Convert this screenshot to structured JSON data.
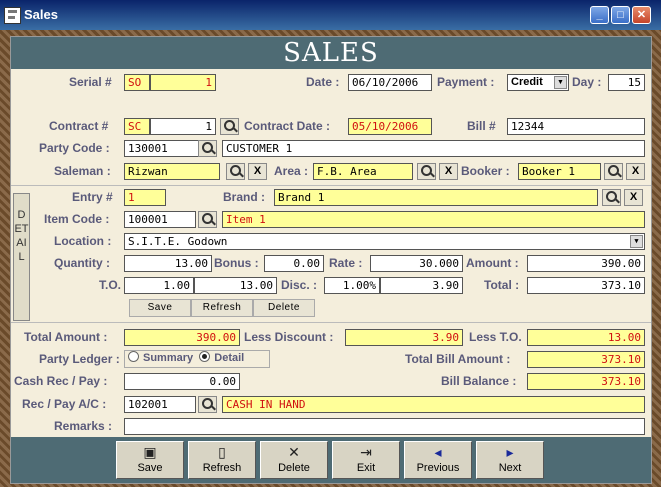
{
  "window": {
    "title": "Sales"
  },
  "banner": "SALES",
  "header": {
    "serial_label": "Serial #",
    "serial_prefix": "SO",
    "serial_no": "1",
    "date_label": "Date :",
    "date": "06/10/2006",
    "payment_label": "Payment :",
    "payment": "Credit",
    "day_label": "Day :",
    "day": "15"
  },
  "contract": {
    "label": "Contract #",
    "prefix": "SC",
    "no": "1",
    "date_label": "Contract Date :",
    "date": "05/10/2006",
    "bill_label": "Bill #",
    "bill": "12344"
  },
  "party": {
    "label": "Party Code :",
    "code": "130001",
    "name": "CUSTOMER 1"
  },
  "people": {
    "saleman_label": "Saleman :",
    "saleman": "Rizwan",
    "area_label": "Area :",
    "area": "F.B. Area",
    "booker_label": "Booker :",
    "booker": "Booker 1"
  },
  "detail": {
    "tab_label": "DETAIL",
    "entry_label": "Entry #",
    "entry": "1",
    "brand_label": "Brand :",
    "brand": "Brand 1",
    "item_code_label": "Item Code :",
    "item_code": "100001",
    "item_name": "Item 1",
    "location_label": "Location :",
    "location": "S.I.T.E. Godown",
    "quantity_label": "Quantity :",
    "quantity": "13.00",
    "bonus_label": "Bonus :",
    "bonus": "0.00",
    "rate_label": "Rate :",
    "rate": "30.000",
    "amount_label": "Amount :",
    "amount": "390.00",
    "to_label": "T.O.",
    "to_a": "1.00",
    "to_b": "13.00",
    "disc_label": "Disc. :",
    "disc_pct": "1.00%",
    "disc_amt": "3.90",
    "total_label": "Total :",
    "total": "373.10",
    "save": "Save",
    "refresh": "Refresh",
    "delete": "Delete"
  },
  "totals": {
    "total_amount_label": "Total Amount :",
    "total_amount": "390.00",
    "less_discount_label": "Less Discount :",
    "less_discount": "3.90",
    "less_to_label": "Less T.O.",
    "less_to": "13.00",
    "party_ledger_label": "Party Ledger :",
    "summary": "Summary",
    "detail": "Detail",
    "total_bill_label": "Total Bill Amount :",
    "total_bill": "373.10",
    "cash_label": "Cash Rec / Pay :",
    "cash": "0.00",
    "bill_balance_label": "Bill Balance :",
    "bill_balance": "373.10",
    "ac_label": "Rec / Pay A/C :",
    "ac_code": "102001",
    "ac_name": "CASH IN HAND",
    "remarks_label": "Remarks :",
    "remarks": ""
  },
  "nav": {
    "save": "Save",
    "refresh": "Refresh",
    "delete": "Delete",
    "exit": "Exit",
    "previous": "Previous",
    "next": "Next"
  }
}
